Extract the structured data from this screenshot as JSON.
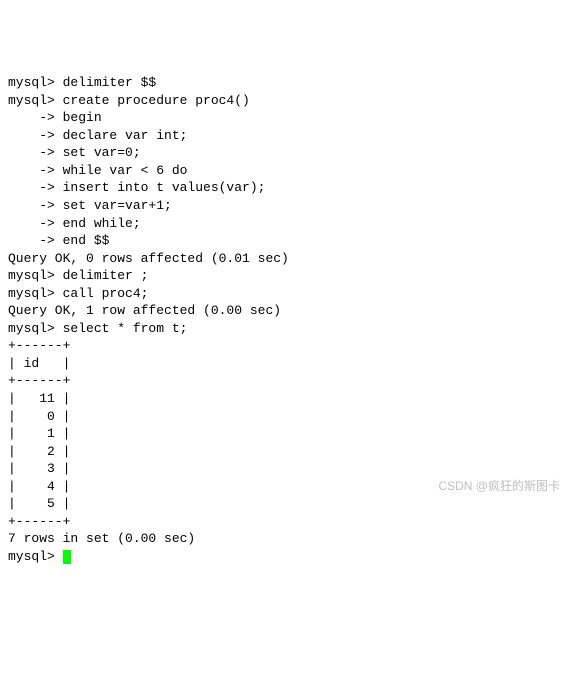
{
  "terminal": {
    "lines": [
      "mysql> delimiter $$",
      "mysql> create procedure proc4()",
      "    -> begin",
      "    -> declare var int;",
      "    -> set var=0;",
      "    -> while var < 6 do",
      "    -> insert into t values(var);",
      "    -> set var=var+1;",
      "    -> end while;",
      "    -> end $$",
      "Query OK, 0 rows affected (0.01 sec)",
      "",
      "mysql> delimiter ;",
      "mysql> call proc4;",
      "Query OK, 1 row affected (0.00 sec)",
      "",
      "mysql> select * from t;",
      "+------+",
      "| id   |",
      "+------+",
      "|   11 |",
      "|    0 |",
      "|    1 |",
      "|    2 |",
      "|    3 |",
      "|    4 |",
      "|    5 |",
      "+------+",
      "7 rows in set (0.00 sec)",
      "",
      "mysql> "
    ]
  },
  "watermark": "CSDN @疯狂的斯图卡",
  "chart_data": {
    "type": "table",
    "title": "select * from t",
    "columns": [
      "id"
    ],
    "rows": [
      [
        11
      ],
      [
        0
      ],
      [
        1
      ],
      [
        2
      ],
      [
        3
      ],
      [
        4
      ],
      [
        5
      ]
    ],
    "row_count": 7,
    "timing_sec": 0.0
  }
}
